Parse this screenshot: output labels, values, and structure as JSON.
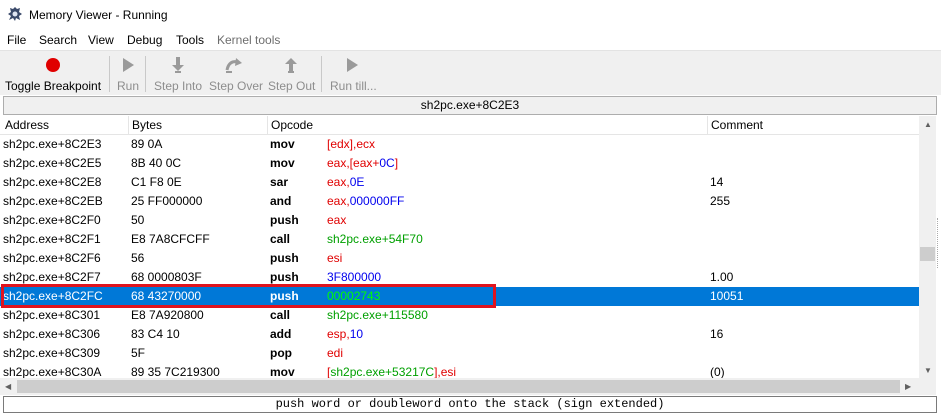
{
  "window": {
    "title": "Memory Viewer - Running"
  },
  "menu": [
    "File",
    "Search",
    "View",
    "Debug",
    "Tools",
    "Kernel tools"
  ],
  "toolbar": {
    "toggle_breakpoint": "Toggle Breakpoint",
    "run": "Run",
    "step_into": "Step Into",
    "step_over": "Step Over",
    "step_out": "Step Out",
    "run_till": "Run till..."
  },
  "address_bar": "sh2pc.exe+8C2E3",
  "columns": {
    "address": "Address",
    "bytes": "Bytes",
    "opcode": "Opcode",
    "comment": "Comment"
  },
  "rows": [
    {
      "address": "sh2pc.exe+8C2E3",
      "bytes": "89 0A",
      "op": "mov",
      "args": [
        [
          "[edx],ecx",
          "r"
        ]
      ],
      "comment": ""
    },
    {
      "address": "sh2pc.exe+8C2E5",
      "bytes": "8B 40 0C",
      "op": "mov",
      "args": [
        [
          "eax,[eax+",
          "r"
        ],
        [
          "0C",
          "b"
        ],
        [
          "]",
          "r"
        ]
      ],
      "comment": ""
    },
    {
      "address": "sh2pc.exe+8C2E8",
      "bytes": "C1 F8 0E",
      "op": "sar",
      "args": [
        [
          "eax,",
          "r"
        ],
        [
          "0E",
          "b"
        ]
      ],
      "comment": "14"
    },
    {
      "address": "sh2pc.exe+8C2EB",
      "bytes": "25 FF000000",
      "op": "and",
      "args": [
        [
          "eax,",
          "r"
        ],
        [
          "000000FF",
          "b"
        ]
      ],
      "comment": "255"
    },
    {
      "address": "sh2pc.exe+8C2F0",
      "bytes": "50",
      "op": "push",
      "args": [
        [
          "eax",
          "r"
        ]
      ],
      "comment": ""
    },
    {
      "address": "sh2pc.exe+8C2F1",
      "bytes": "E8 7A8CFCFF",
      "op": "call",
      "args": [
        [
          "sh2pc.exe+54F70",
          "g"
        ]
      ],
      "comment": ""
    },
    {
      "address": "sh2pc.exe+8C2F6",
      "bytes": "56",
      "op": "push",
      "args": [
        [
          "esi",
          "r"
        ]
      ],
      "comment": ""
    },
    {
      "address": "sh2pc.exe+8C2F7",
      "bytes": "68 0000803F",
      "op": "push",
      "args": [
        [
          "3F800000",
          "b"
        ]
      ],
      "comment": "1.00"
    },
    {
      "address": "sh2pc.exe+8C2FC",
      "bytes": "68 43270000",
      "op": "push",
      "args": [
        [
          "00002743",
          "g"
        ]
      ],
      "comment": "10051",
      "selected": true
    },
    {
      "address": "sh2pc.exe+8C301",
      "bytes": "E8 7A920800",
      "op": "call",
      "args": [
        [
          "sh2pc.exe+115580",
          "g"
        ]
      ],
      "comment": ""
    },
    {
      "address": "sh2pc.exe+8C306",
      "bytes": "83 C4 10",
      "op": "add",
      "args": [
        [
          "esp,",
          "r"
        ],
        [
          "10",
          "b"
        ]
      ],
      "comment": "16"
    },
    {
      "address": "sh2pc.exe+8C309",
      "bytes": "5F",
      "op": "pop",
      "args": [
        [
          "edi",
          "r"
        ]
      ],
      "comment": ""
    },
    {
      "address": "sh2pc.exe+8C30A",
      "bytes": "89 35 7C219300",
      "op": "mov",
      "args": [
        [
          "[",
          "r"
        ],
        [
          "sh2pc.exe+53217C",
          "g"
        ],
        [
          "],esi",
          "r"
        ]
      ],
      "comment": "(0)"
    }
  ],
  "status": "push word or doubleword onto the stack (sign extended)",
  "colors": {
    "selection": "#0078d7",
    "highlight_box": "#e0141e",
    "register": "#e00000",
    "constant": "#0000ee",
    "address_ref": "#00a000"
  }
}
